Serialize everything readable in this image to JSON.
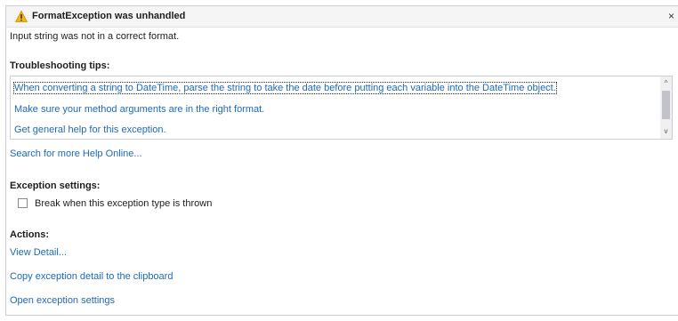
{
  "dialog": {
    "title": "FormatException was unhandled",
    "close_glyph": "×",
    "message": "Input string was not in a correct format.",
    "warning_icon": "warning-icon",
    "warning_color": "#f5b800"
  },
  "tips": {
    "heading": "Troubleshooting tips:",
    "items": [
      "When converting a string to DateTime, parse the string to take the date before putting each variable into the DateTime object.",
      "Make sure your method arguments are in the right format.",
      "Get general help for this exception."
    ],
    "scroll_up": "^",
    "scroll_down": "v"
  },
  "search_link": "Search for more Help Online...",
  "exception_settings": {
    "heading": "Exception settings:",
    "checkbox_label": "Break when this exception type is thrown",
    "checked": false
  },
  "actions": {
    "heading": "Actions:",
    "items": [
      "View Detail...",
      "Copy exception detail to the clipboard",
      "Open exception settings"
    ]
  },
  "colors": {
    "link": "#1e6ab8",
    "border": "#cccedb",
    "titlebar": "#f5f5f5"
  }
}
